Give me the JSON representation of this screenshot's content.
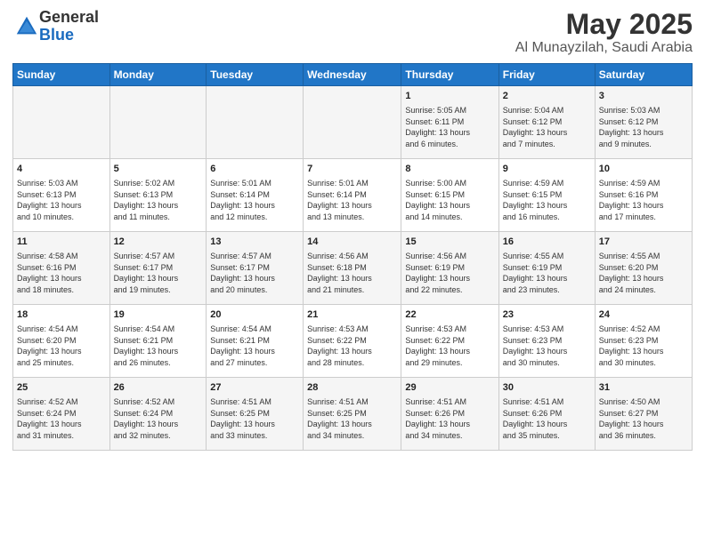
{
  "logo": {
    "general": "General",
    "blue": "Blue"
  },
  "title": "May 2025",
  "subtitle": "Al Munayzilah, Saudi Arabia",
  "days_header": [
    "Sunday",
    "Monday",
    "Tuesday",
    "Wednesday",
    "Thursday",
    "Friday",
    "Saturday"
  ],
  "weeks": [
    [
      {
        "day": "",
        "info": ""
      },
      {
        "day": "",
        "info": ""
      },
      {
        "day": "",
        "info": ""
      },
      {
        "day": "",
        "info": ""
      },
      {
        "day": "1",
        "info": "Sunrise: 5:05 AM\nSunset: 6:11 PM\nDaylight: 13 hours\nand 6 minutes."
      },
      {
        "day": "2",
        "info": "Sunrise: 5:04 AM\nSunset: 6:12 PM\nDaylight: 13 hours\nand 7 minutes."
      },
      {
        "day": "3",
        "info": "Sunrise: 5:03 AM\nSunset: 6:12 PM\nDaylight: 13 hours\nand 9 minutes."
      }
    ],
    [
      {
        "day": "4",
        "info": "Sunrise: 5:03 AM\nSunset: 6:13 PM\nDaylight: 13 hours\nand 10 minutes."
      },
      {
        "day": "5",
        "info": "Sunrise: 5:02 AM\nSunset: 6:13 PM\nDaylight: 13 hours\nand 11 minutes."
      },
      {
        "day": "6",
        "info": "Sunrise: 5:01 AM\nSunset: 6:14 PM\nDaylight: 13 hours\nand 12 minutes."
      },
      {
        "day": "7",
        "info": "Sunrise: 5:01 AM\nSunset: 6:14 PM\nDaylight: 13 hours\nand 13 minutes."
      },
      {
        "day": "8",
        "info": "Sunrise: 5:00 AM\nSunset: 6:15 PM\nDaylight: 13 hours\nand 14 minutes."
      },
      {
        "day": "9",
        "info": "Sunrise: 4:59 AM\nSunset: 6:15 PM\nDaylight: 13 hours\nand 16 minutes."
      },
      {
        "day": "10",
        "info": "Sunrise: 4:59 AM\nSunset: 6:16 PM\nDaylight: 13 hours\nand 17 minutes."
      }
    ],
    [
      {
        "day": "11",
        "info": "Sunrise: 4:58 AM\nSunset: 6:16 PM\nDaylight: 13 hours\nand 18 minutes."
      },
      {
        "day": "12",
        "info": "Sunrise: 4:57 AM\nSunset: 6:17 PM\nDaylight: 13 hours\nand 19 minutes."
      },
      {
        "day": "13",
        "info": "Sunrise: 4:57 AM\nSunset: 6:17 PM\nDaylight: 13 hours\nand 20 minutes."
      },
      {
        "day": "14",
        "info": "Sunrise: 4:56 AM\nSunset: 6:18 PM\nDaylight: 13 hours\nand 21 minutes."
      },
      {
        "day": "15",
        "info": "Sunrise: 4:56 AM\nSunset: 6:19 PM\nDaylight: 13 hours\nand 22 minutes."
      },
      {
        "day": "16",
        "info": "Sunrise: 4:55 AM\nSunset: 6:19 PM\nDaylight: 13 hours\nand 23 minutes."
      },
      {
        "day": "17",
        "info": "Sunrise: 4:55 AM\nSunset: 6:20 PM\nDaylight: 13 hours\nand 24 minutes."
      }
    ],
    [
      {
        "day": "18",
        "info": "Sunrise: 4:54 AM\nSunset: 6:20 PM\nDaylight: 13 hours\nand 25 minutes."
      },
      {
        "day": "19",
        "info": "Sunrise: 4:54 AM\nSunset: 6:21 PM\nDaylight: 13 hours\nand 26 minutes."
      },
      {
        "day": "20",
        "info": "Sunrise: 4:54 AM\nSunset: 6:21 PM\nDaylight: 13 hours\nand 27 minutes."
      },
      {
        "day": "21",
        "info": "Sunrise: 4:53 AM\nSunset: 6:22 PM\nDaylight: 13 hours\nand 28 minutes."
      },
      {
        "day": "22",
        "info": "Sunrise: 4:53 AM\nSunset: 6:22 PM\nDaylight: 13 hours\nand 29 minutes."
      },
      {
        "day": "23",
        "info": "Sunrise: 4:53 AM\nSunset: 6:23 PM\nDaylight: 13 hours\nand 30 minutes."
      },
      {
        "day": "24",
        "info": "Sunrise: 4:52 AM\nSunset: 6:23 PM\nDaylight: 13 hours\nand 30 minutes."
      }
    ],
    [
      {
        "day": "25",
        "info": "Sunrise: 4:52 AM\nSunset: 6:24 PM\nDaylight: 13 hours\nand 31 minutes."
      },
      {
        "day": "26",
        "info": "Sunrise: 4:52 AM\nSunset: 6:24 PM\nDaylight: 13 hours\nand 32 minutes."
      },
      {
        "day": "27",
        "info": "Sunrise: 4:51 AM\nSunset: 6:25 PM\nDaylight: 13 hours\nand 33 minutes."
      },
      {
        "day": "28",
        "info": "Sunrise: 4:51 AM\nSunset: 6:25 PM\nDaylight: 13 hours\nand 34 minutes."
      },
      {
        "day": "29",
        "info": "Sunrise: 4:51 AM\nSunset: 6:26 PM\nDaylight: 13 hours\nand 34 minutes."
      },
      {
        "day": "30",
        "info": "Sunrise: 4:51 AM\nSunset: 6:26 PM\nDaylight: 13 hours\nand 35 minutes."
      },
      {
        "day": "31",
        "info": "Sunrise: 4:50 AM\nSunset: 6:27 PM\nDaylight: 13 hours\nand 36 minutes."
      }
    ]
  ]
}
